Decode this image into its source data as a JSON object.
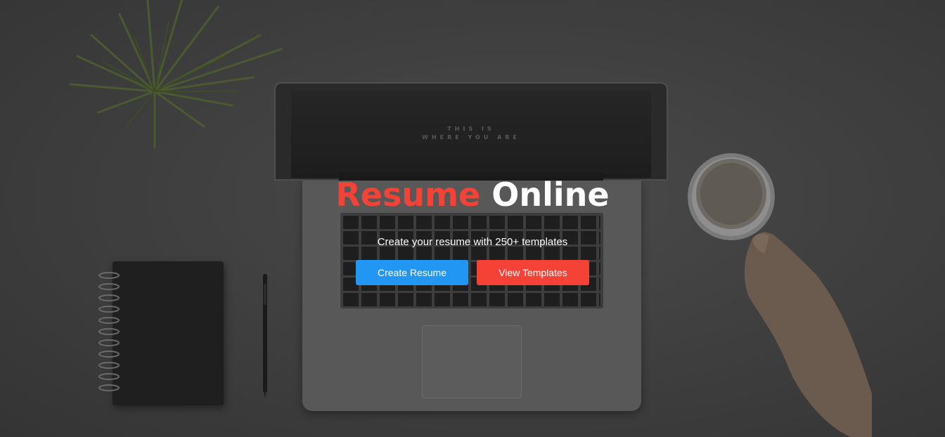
{
  "hero": {
    "title_accent": "Resume",
    "title_main": "Online",
    "subtitle": "Create your resume with 250+ templates",
    "buttons": {
      "create": "Create Resume",
      "templates": "View Templates"
    }
  },
  "laptop_screen": {
    "line1": "THIS IS",
    "line2": "WHERE YOU ARE"
  },
  "colors": {
    "accent_red": "#f44336",
    "primary_blue": "#2196f3",
    "text_white": "#ffffff"
  },
  "icons": [
    "plant-illustration",
    "laptop-illustration",
    "notebook-illustration",
    "pen-illustration",
    "coffee-cup-illustration",
    "hand-illustration"
  ]
}
